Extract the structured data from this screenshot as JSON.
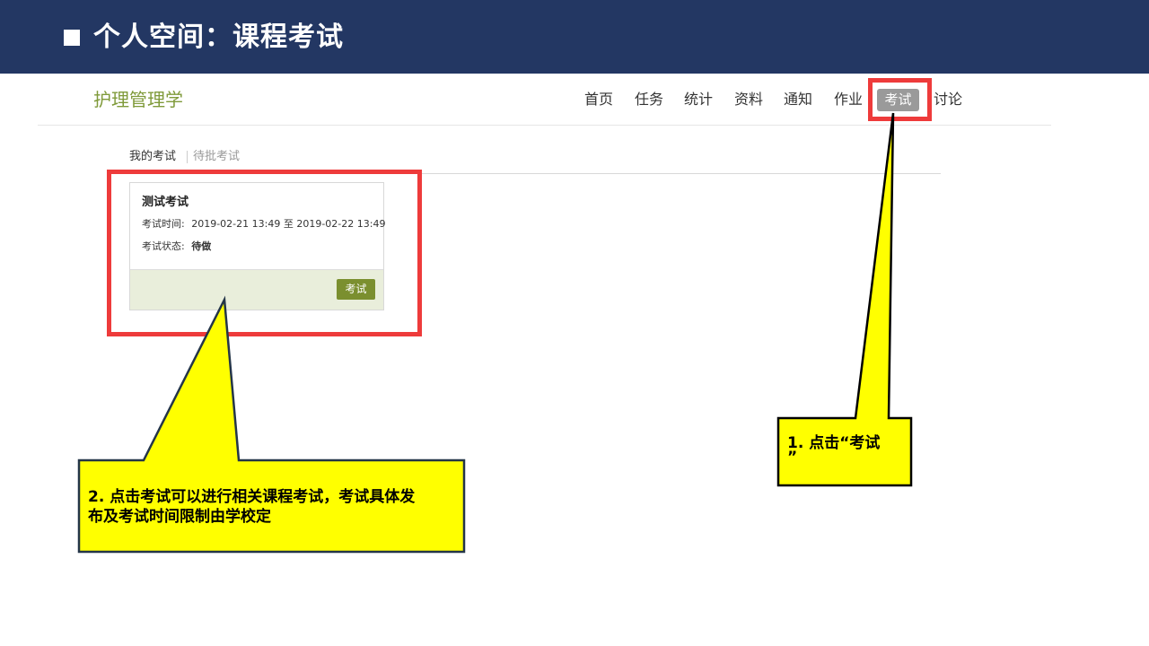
{
  "slide": {
    "title": "个人空间：课程考试"
  },
  "course": {
    "name": "护理管理学"
  },
  "nav": {
    "items": [
      "首页",
      "任务",
      "统计",
      "资料",
      "通知",
      "作业"
    ],
    "active": "考试",
    "last": "讨论"
  },
  "tabs": {
    "active": "我的考试",
    "inactive": "待批考试"
  },
  "exam": {
    "name": "测试考试",
    "time_label": "考试时间:",
    "time_value": "2019-02-21 13:49 至 2019-02-22 13:49",
    "status_label": "考试状态:",
    "status_value": "待做",
    "button_label": "考试"
  },
  "callouts": {
    "step1_line1": "1. 点击“考试",
    "step1_line2": "”",
    "step2_line1": "2. 点击考试可以进行相关课程考试，考试具体发",
    "step2_line2": "布及考试时间限制由学校定"
  },
  "colors": {
    "title_bar": "#233763",
    "brand_green": "#7f9a3a",
    "highlight_red": "#ee3b3b",
    "callout_yellow": "#ffff00",
    "nav_active_bg": "#9a9a9a"
  }
}
